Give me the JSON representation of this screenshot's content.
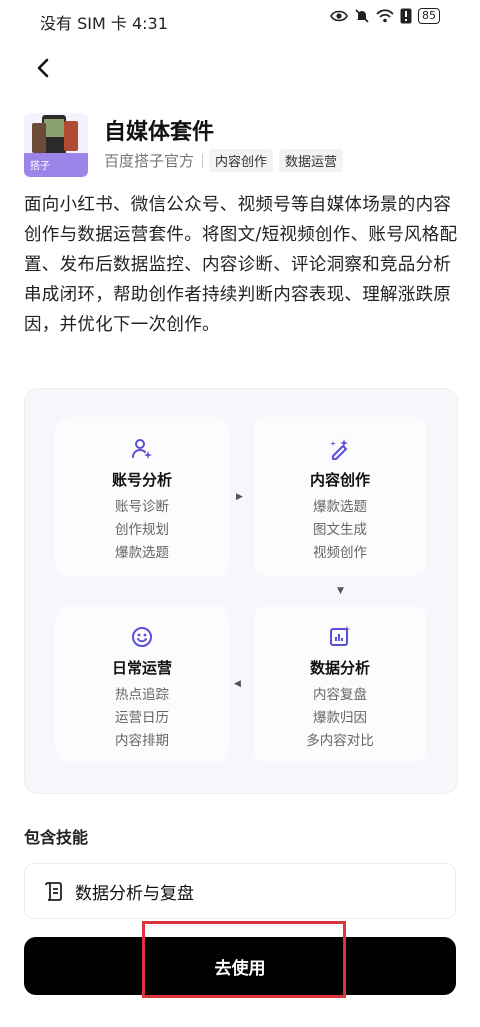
{
  "status_bar": {
    "carrier_time": "没有 SIM 卡 4:31",
    "battery": "85"
  },
  "header": {
    "title": "自媒体套件",
    "icon_badge": "搭子",
    "publisher": "百度搭子官方",
    "tags": [
      "内容创作",
      "数据运营"
    ]
  },
  "description": "面向小红书、微信公众号、视频号等自媒体场景的内容创作与数据运营套件。将图文/短视频创作、账号风格配置、发布后数据监控、内容诊断、评论洞察和竞品分析串成闭环，帮助创作者持续判断内容表现、理解涨跌原因，并优化下一次创作。",
  "flow": {
    "account": {
      "title": "账号分析",
      "items": [
        "账号诊断",
        "创作规划",
        "爆款选题"
      ],
      "icon": "user-sparkle-icon"
    },
    "content": {
      "title": "内容创作",
      "items": [
        "爆款选题",
        "图文生成",
        "视频创作"
      ],
      "icon": "magic-pen-icon"
    },
    "daily": {
      "title": "日常运营",
      "items": [
        "热点追踪",
        "运营日历",
        "内容排期"
      ],
      "icon": "smiley-icon"
    },
    "data": {
      "title": "数据分析",
      "items": [
        "内容复盘",
        "爆款归因",
        "多内容对比"
      ],
      "icon": "chart-icon"
    }
  },
  "skills": {
    "label": "包含技能",
    "items": [
      {
        "name": "数据分析与复盘",
        "icon": "scroll-icon"
      }
    ]
  },
  "action": {
    "use_label": "去使用"
  },
  "colors": {
    "accent": "#5b4fd6",
    "button_bg": "#000000",
    "highlight": "#d9363e"
  }
}
